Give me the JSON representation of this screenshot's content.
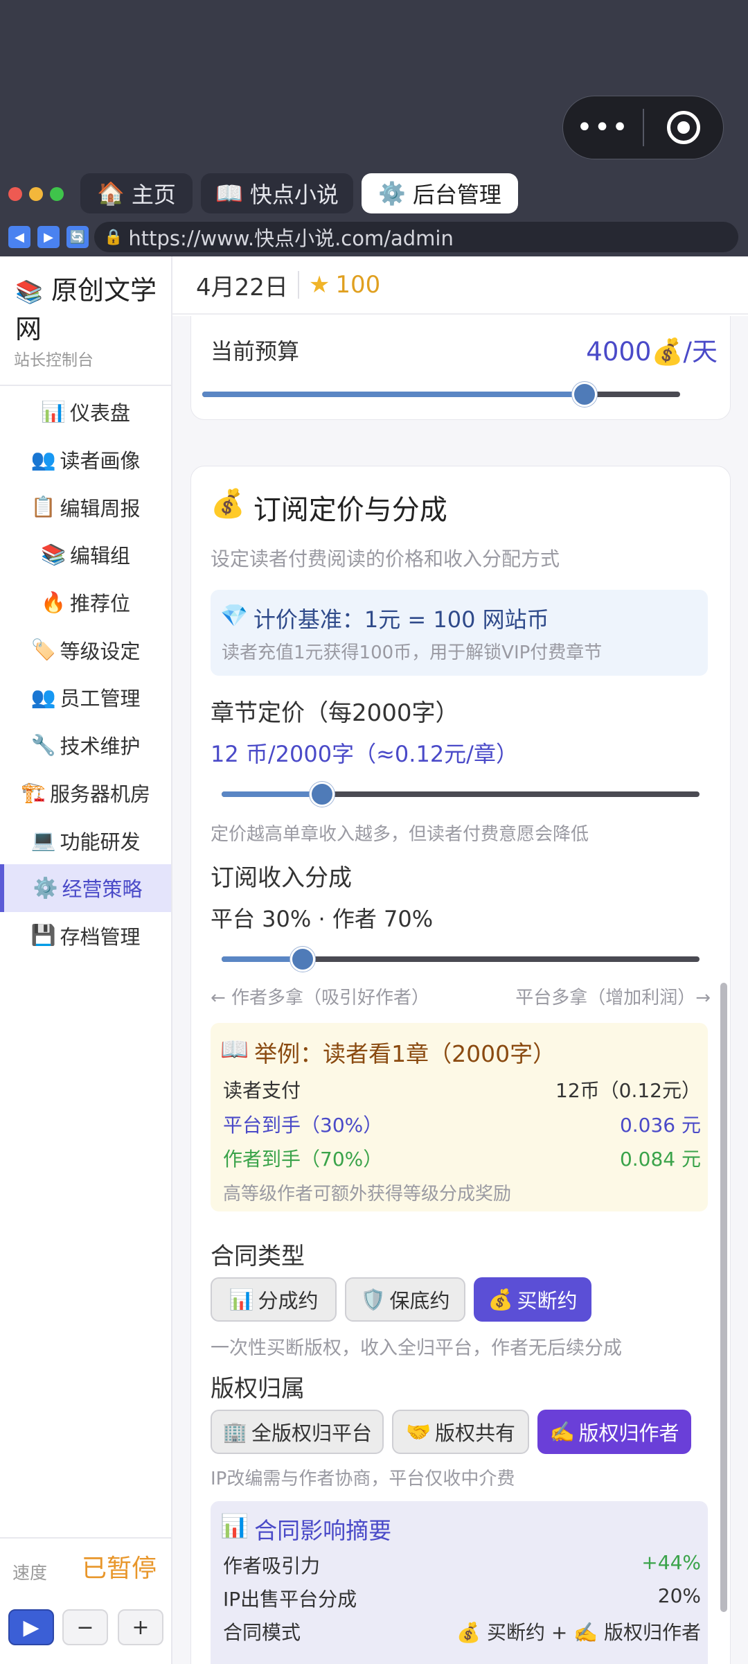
{
  "capsule": {
    "more_icon": "•••",
    "target_icon": "target-icon"
  },
  "window_controls": {
    "colors": [
      "#ee5a52",
      "#f3b73b",
      "#3fc44b"
    ]
  },
  "tabs": [
    {
      "icon": "🏠",
      "label": "主页"
    },
    {
      "icon": "📖",
      "label": "快点小说"
    },
    {
      "icon": "⚙️",
      "label": "后台管理"
    }
  ],
  "address": {
    "back": "◀",
    "forward": "▶",
    "refresh": "🔄",
    "lock": "🔒",
    "url": "https://www.快点小说.com/admin"
  },
  "brand": {
    "icon": "📚",
    "name": "原创文学网",
    "subtitle": "站长控制台"
  },
  "sidebar": {
    "items": [
      {
        "icon": "📊",
        "label": "仪表盘"
      },
      {
        "icon": "👥",
        "label": "读者画像"
      },
      {
        "icon": "📋",
        "label": "编辑周报"
      },
      {
        "icon": "📚",
        "label": "编辑组"
      },
      {
        "icon": "🔥",
        "label": "推荐位"
      },
      {
        "icon": "🏷️",
        "label": "等级设定"
      },
      {
        "icon": "👥",
        "label": "员工管理"
      },
      {
        "icon": "🔧",
        "label": "技术维护"
      },
      {
        "icon": "🏗️",
        "label": "服务器机房"
      },
      {
        "icon": "💻",
        "label": "功能研发"
      },
      {
        "icon": "⚙️",
        "label": "经营策略"
      },
      {
        "icon": "💾",
        "label": "存档管理"
      }
    ]
  },
  "speed": {
    "label": "速度",
    "status": "已暂停",
    "play": "▶",
    "minus": "−",
    "plus": "+"
  },
  "header": {
    "date": "4月22日",
    "star": "★",
    "score": "100"
  },
  "budget": {
    "label": "当前预算",
    "value": "4000💰/天",
    "level": 0.8
  },
  "pricing": {
    "title_icon": "💰",
    "title": "订阅定价与分成",
    "desc": "设定读者付费阅读的价格和收入分配方式",
    "base_icon": "💎",
    "base_title": "计价基准：1元 = 100 网站币",
    "base_desc": "读者充值1元获得100币，用于解锁VIP付费章节",
    "chapter_label": "章节定价（每2000字）",
    "chapter_value": "12 币/2000字（≈0.12元/章）",
    "chapter_level": 0.21,
    "chapter_hint": "定价越高单章收入越多，但读者付费意愿会降低",
    "split_label": "订阅收入分成",
    "split_value": "平台 30% · 作者 70%",
    "split_level": 0.17,
    "split_left": "← 作者多拿（吸引好作者）",
    "split_right": "平台多拿（增加利润）→"
  },
  "example": {
    "icon": "📖",
    "title": "举例：读者看1章（2000字）",
    "rows": [
      {
        "label": "读者支付",
        "value": "12币（0.12元）",
        "color": "#333333"
      },
      {
        "label": "平台到手（30%）",
        "value": "0.036 元",
        "color": "#4a4ac8"
      },
      {
        "label": "作者到手（70%）",
        "value": "0.084 元",
        "color": "#3aa34a"
      }
    ],
    "note": "高等级作者可额外获得等级分成奖励"
  },
  "contract": {
    "label": "合同类型",
    "options": [
      {
        "icon": "📊",
        "label": "分成约",
        "selected": false
      },
      {
        "icon": "🛡️",
        "label": "保底约",
        "selected": false
      },
      {
        "icon": "💰",
        "label": "买断约",
        "selected": true
      }
    ],
    "hint": "一次性买断版权，收入全归平台，作者无后续分成"
  },
  "copyright": {
    "label": "版权归属",
    "options": [
      {
        "icon": "🏢",
        "label": "全版权归平台",
        "selected": false
      },
      {
        "icon": "🤝",
        "label": "版权共有",
        "selected": false
      },
      {
        "icon": "✍️",
        "label": "版权归作者",
        "selected": true
      }
    ],
    "hint": "IP改编需与作者协商，平台仅收中介费"
  },
  "summary": {
    "icon": "📊",
    "title": "合同影响摘要",
    "rows": [
      {
        "label": "作者吸引力",
        "value": "+44%",
        "color": "#3aa34a"
      },
      {
        "label": "IP出售平台分成",
        "value": "20%",
        "color": "#333333"
      },
      {
        "label": "合同模式",
        "value": "💰 买断约 + ✍️ 版权归作者",
        "color": "#333333"
      }
    ]
  },
  "colors": {
    "accent": "#5b4fd6",
    "active_menu_bg": "#e4e4fb",
    "paused": "#e8962a",
    "budget_value": "#4a4ac8"
  }
}
